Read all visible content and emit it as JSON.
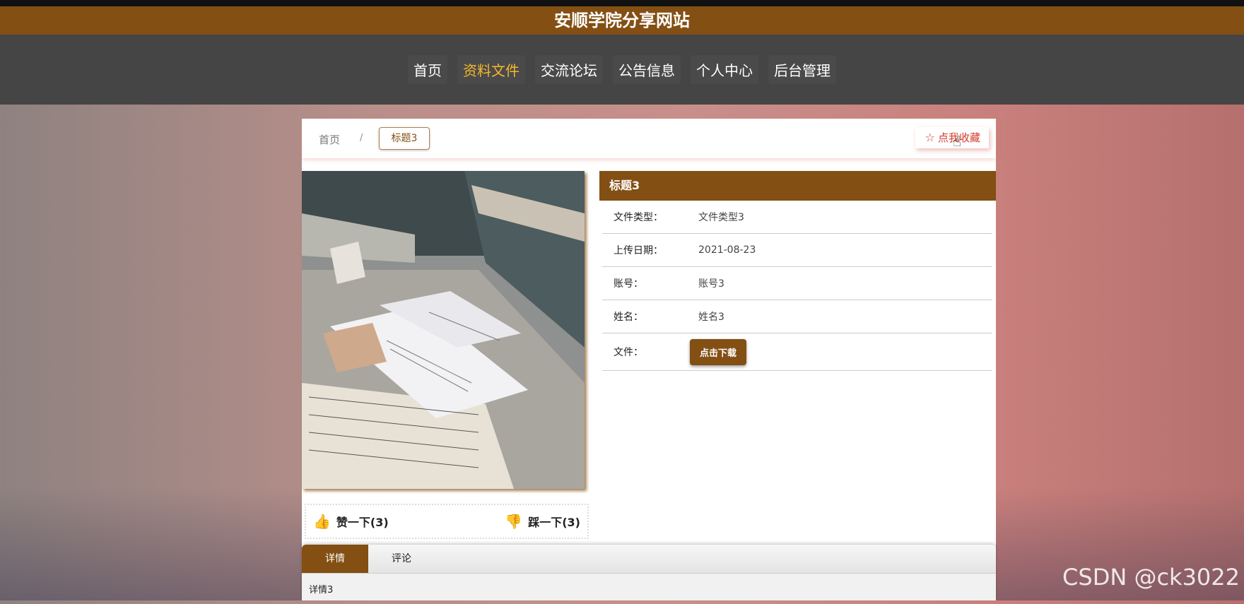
{
  "site": {
    "title": "安顺学院分享网站"
  },
  "nav": {
    "items": [
      {
        "label": "首页",
        "active": false
      },
      {
        "label": "资料文件",
        "active": true
      },
      {
        "label": "交流论坛",
        "active": false
      },
      {
        "label": "公告信息",
        "active": false
      },
      {
        "label": "个人中心",
        "active": false
      },
      {
        "label": "后台管理",
        "active": false
      }
    ]
  },
  "breadcrumb": {
    "home": "首页",
    "separator": "/",
    "current": "标题3"
  },
  "favorite": {
    "label": "点我收藏",
    "icon": "star-outline-icon"
  },
  "detail": {
    "title": "标题3",
    "rows": [
      {
        "label": "文件类型：",
        "value": "文件类型3"
      },
      {
        "label": "上传日期：",
        "value": "2021-08-23"
      },
      {
        "label": "账号：",
        "value": "账号3"
      },
      {
        "label": "姓名：",
        "value": "姓名3"
      }
    ],
    "file_label": "文件：",
    "download_label": "点击下载"
  },
  "votes": {
    "like_label": "赞一下(3)",
    "dislike_label": "踩一下(3)"
  },
  "tabs": {
    "items": [
      {
        "label": "详情",
        "active": true
      },
      {
        "label": "评论",
        "active": false
      }
    ],
    "content": "详情3"
  },
  "watermark": "CSDN @ck3022",
  "colors": {
    "brand": "#834f13",
    "nav_bg": "#454545",
    "accent": "#f5b82a",
    "red": "#d23b2a"
  }
}
